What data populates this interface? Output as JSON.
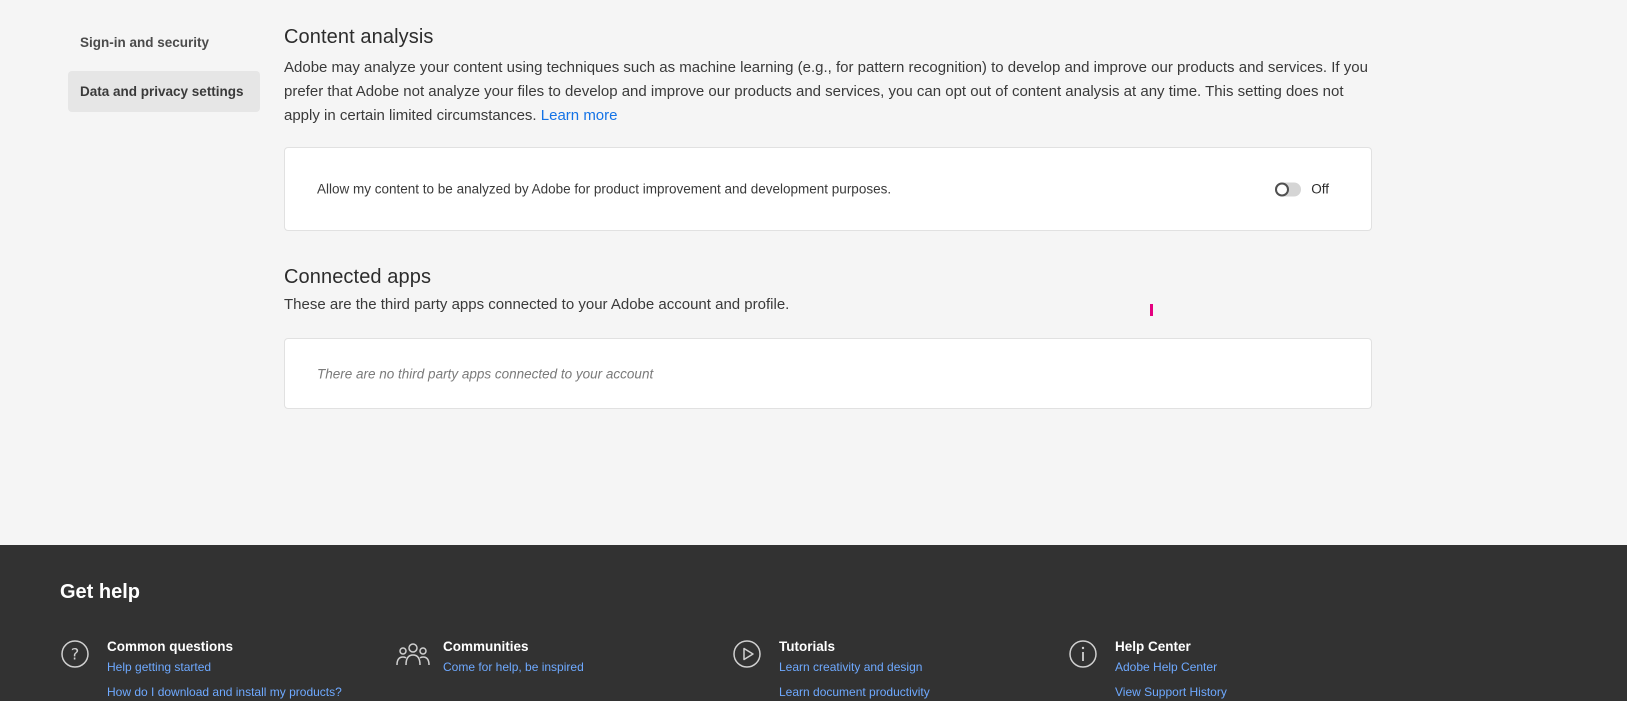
{
  "sidebar": {
    "items": [
      {
        "label": "Sign-in and security"
      },
      {
        "label": "Data and privacy settings"
      }
    ]
  },
  "content_analysis": {
    "title": "Content analysis",
    "description": "Adobe may analyze your content using techniques such as machine learning (e.g., for pattern recognition) to develop and improve our products and services. If you prefer that Adobe not analyze your files to develop and improve our products and services, you can opt out of content analysis at any time. This setting does not apply in certain limited circumstances.",
    "learn_more": "Learn more",
    "setting_label": "Allow my content to be analyzed by Adobe for product improvement and development purposes.",
    "toggle_state": "Off"
  },
  "connected_apps": {
    "title": "Connected apps",
    "description": "These are the third party apps connected to your Adobe account and profile.",
    "empty_message": "There are no third party apps connected to your account"
  },
  "footer": {
    "title": "Get help",
    "columns": [
      {
        "heading": "Common questions",
        "icon": "question-icon",
        "links": [
          "Help getting started",
          "How do I download and install my products?"
        ]
      },
      {
        "heading": "Communities",
        "icon": "people-icon",
        "links": [
          "Come for help, be inspired"
        ]
      },
      {
        "heading": "Tutorials",
        "icon": "play-icon",
        "links": [
          "Learn creativity and design",
          "Learn document productivity"
        ]
      },
      {
        "heading": "Help Center",
        "icon": "info-icon",
        "links": [
          "Adobe Help Center",
          "View Support History"
        ]
      }
    ]
  },
  "colors": {
    "link": "#1473e6",
    "footer_link": "#6ea9ff",
    "footer_bg": "#323232"
  }
}
